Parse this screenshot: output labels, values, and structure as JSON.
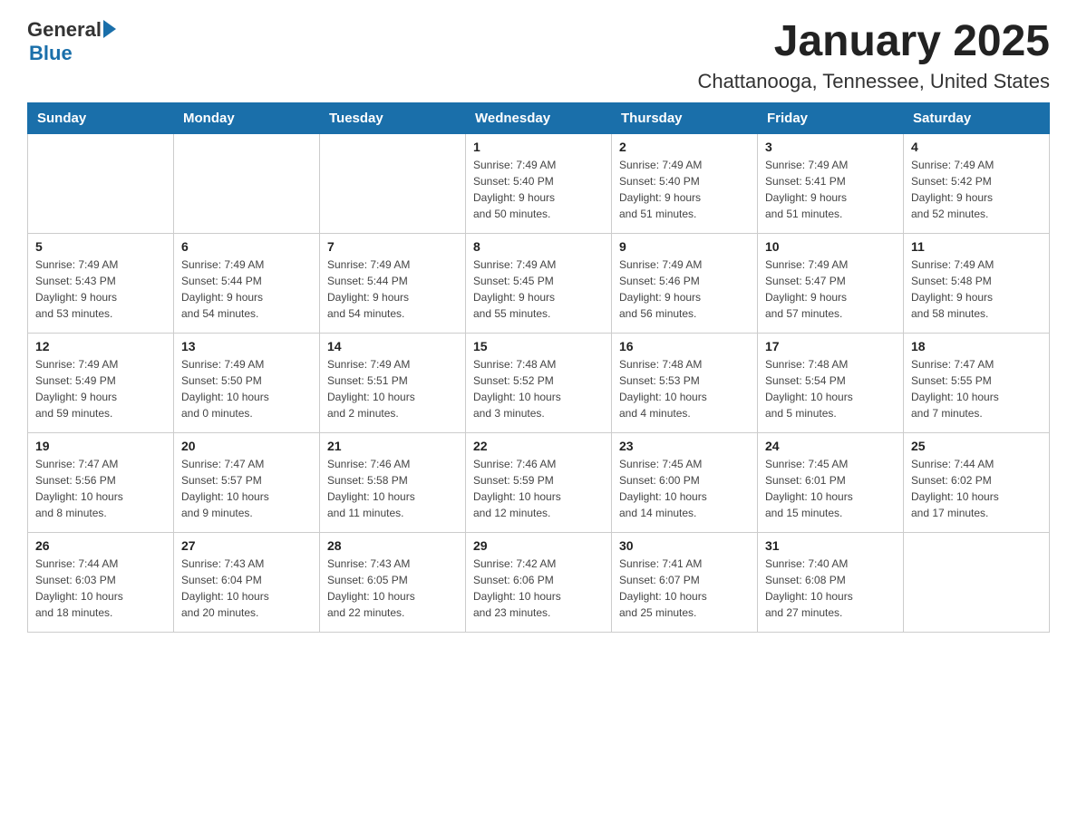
{
  "header": {
    "logo_general": "General",
    "logo_blue": "Blue",
    "month_title": "January 2025",
    "location": "Chattanooga, Tennessee, United States"
  },
  "days_of_week": [
    "Sunday",
    "Monday",
    "Tuesday",
    "Wednesday",
    "Thursday",
    "Friday",
    "Saturday"
  ],
  "weeks": [
    [
      {
        "day": "",
        "info": ""
      },
      {
        "day": "",
        "info": ""
      },
      {
        "day": "",
        "info": ""
      },
      {
        "day": "1",
        "info": "Sunrise: 7:49 AM\nSunset: 5:40 PM\nDaylight: 9 hours\nand 50 minutes."
      },
      {
        "day": "2",
        "info": "Sunrise: 7:49 AM\nSunset: 5:40 PM\nDaylight: 9 hours\nand 51 minutes."
      },
      {
        "day": "3",
        "info": "Sunrise: 7:49 AM\nSunset: 5:41 PM\nDaylight: 9 hours\nand 51 minutes."
      },
      {
        "day": "4",
        "info": "Sunrise: 7:49 AM\nSunset: 5:42 PM\nDaylight: 9 hours\nand 52 minutes."
      }
    ],
    [
      {
        "day": "5",
        "info": "Sunrise: 7:49 AM\nSunset: 5:43 PM\nDaylight: 9 hours\nand 53 minutes."
      },
      {
        "day": "6",
        "info": "Sunrise: 7:49 AM\nSunset: 5:44 PM\nDaylight: 9 hours\nand 54 minutes."
      },
      {
        "day": "7",
        "info": "Sunrise: 7:49 AM\nSunset: 5:44 PM\nDaylight: 9 hours\nand 54 minutes."
      },
      {
        "day": "8",
        "info": "Sunrise: 7:49 AM\nSunset: 5:45 PM\nDaylight: 9 hours\nand 55 minutes."
      },
      {
        "day": "9",
        "info": "Sunrise: 7:49 AM\nSunset: 5:46 PM\nDaylight: 9 hours\nand 56 minutes."
      },
      {
        "day": "10",
        "info": "Sunrise: 7:49 AM\nSunset: 5:47 PM\nDaylight: 9 hours\nand 57 minutes."
      },
      {
        "day": "11",
        "info": "Sunrise: 7:49 AM\nSunset: 5:48 PM\nDaylight: 9 hours\nand 58 minutes."
      }
    ],
    [
      {
        "day": "12",
        "info": "Sunrise: 7:49 AM\nSunset: 5:49 PM\nDaylight: 9 hours\nand 59 minutes."
      },
      {
        "day": "13",
        "info": "Sunrise: 7:49 AM\nSunset: 5:50 PM\nDaylight: 10 hours\nand 0 minutes."
      },
      {
        "day": "14",
        "info": "Sunrise: 7:49 AM\nSunset: 5:51 PM\nDaylight: 10 hours\nand 2 minutes."
      },
      {
        "day": "15",
        "info": "Sunrise: 7:48 AM\nSunset: 5:52 PM\nDaylight: 10 hours\nand 3 minutes."
      },
      {
        "day": "16",
        "info": "Sunrise: 7:48 AM\nSunset: 5:53 PM\nDaylight: 10 hours\nand 4 minutes."
      },
      {
        "day": "17",
        "info": "Sunrise: 7:48 AM\nSunset: 5:54 PM\nDaylight: 10 hours\nand 5 minutes."
      },
      {
        "day": "18",
        "info": "Sunrise: 7:47 AM\nSunset: 5:55 PM\nDaylight: 10 hours\nand 7 minutes."
      }
    ],
    [
      {
        "day": "19",
        "info": "Sunrise: 7:47 AM\nSunset: 5:56 PM\nDaylight: 10 hours\nand 8 minutes."
      },
      {
        "day": "20",
        "info": "Sunrise: 7:47 AM\nSunset: 5:57 PM\nDaylight: 10 hours\nand 9 minutes."
      },
      {
        "day": "21",
        "info": "Sunrise: 7:46 AM\nSunset: 5:58 PM\nDaylight: 10 hours\nand 11 minutes."
      },
      {
        "day": "22",
        "info": "Sunrise: 7:46 AM\nSunset: 5:59 PM\nDaylight: 10 hours\nand 12 minutes."
      },
      {
        "day": "23",
        "info": "Sunrise: 7:45 AM\nSunset: 6:00 PM\nDaylight: 10 hours\nand 14 minutes."
      },
      {
        "day": "24",
        "info": "Sunrise: 7:45 AM\nSunset: 6:01 PM\nDaylight: 10 hours\nand 15 minutes."
      },
      {
        "day": "25",
        "info": "Sunrise: 7:44 AM\nSunset: 6:02 PM\nDaylight: 10 hours\nand 17 minutes."
      }
    ],
    [
      {
        "day": "26",
        "info": "Sunrise: 7:44 AM\nSunset: 6:03 PM\nDaylight: 10 hours\nand 18 minutes."
      },
      {
        "day": "27",
        "info": "Sunrise: 7:43 AM\nSunset: 6:04 PM\nDaylight: 10 hours\nand 20 minutes."
      },
      {
        "day": "28",
        "info": "Sunrise: 7:43 AM\nSunset: 6:05 PM\nDaylight: 10 hours\nand 22 minutes."
      },
      {
        "day": "29",
        "info": "Sunrise: 7:42 AM\nSunset: 6:06 PM\nDaylight: 10 hours\nand 23 minutes."
      },
      {
        "day": "30",
        "info": "Sunrise: 7:41 AM\nSunset: 6:07 PM\nDaylight: 10 hours\nand 25 minutes."
      },
      {
        "day": "31",
        "info": "Sunrise: 7:40 AM\nSunset: 6:08 PM\nDaylight: 10 hours\nand 27 minutes."
      },
      {
        "day": "",
        "info": ""
      }
    ]
  ]
}
